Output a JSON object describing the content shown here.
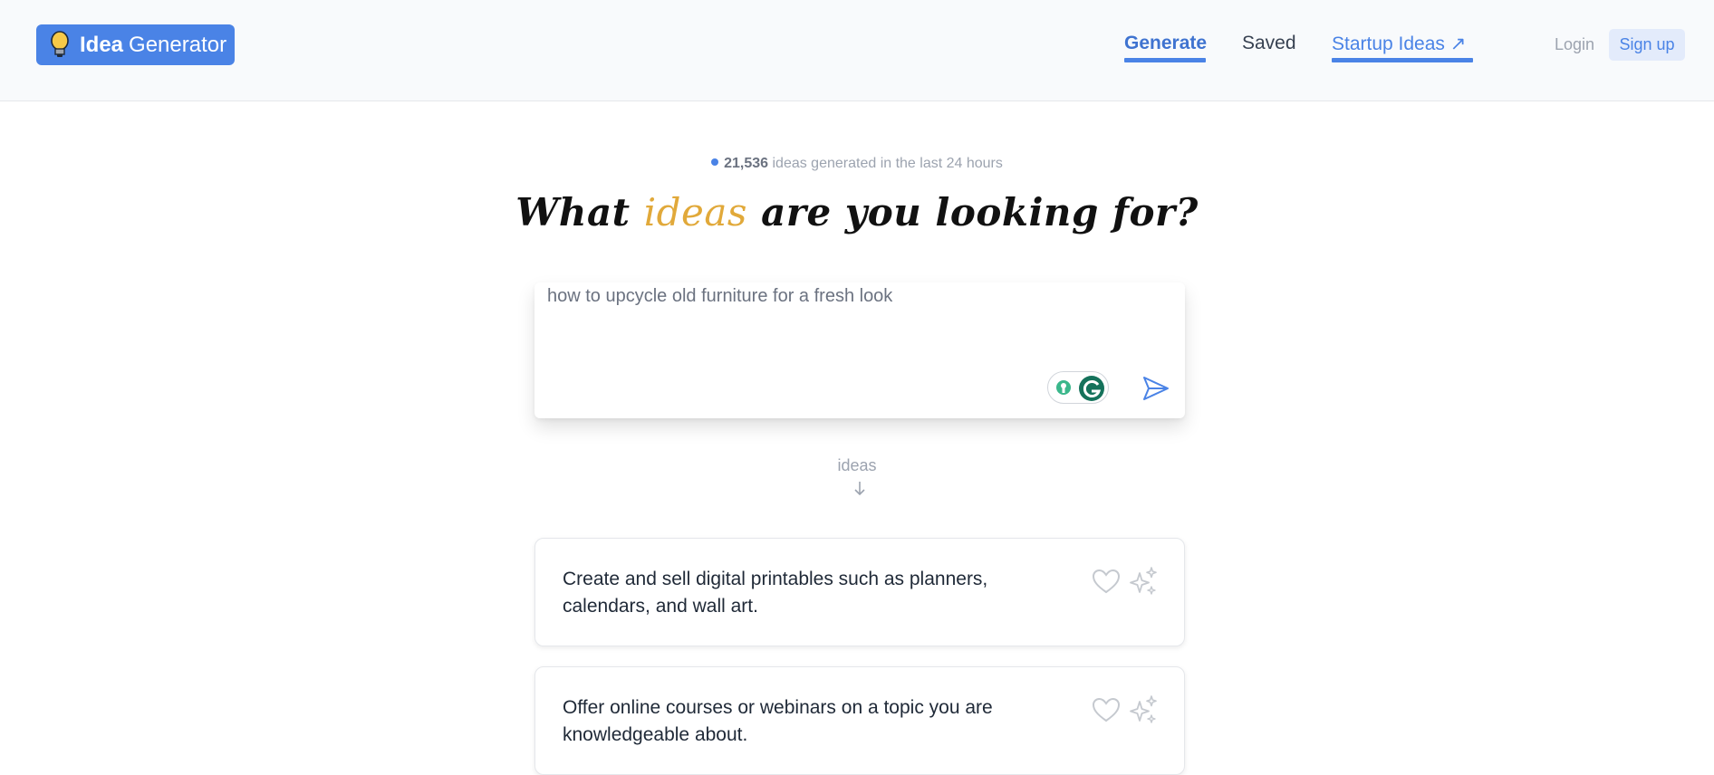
{
  "header": {
    "logo_bold": "Idea",
    "logo_rest": "Generator",
    "nav": {
      "generate": "Generate",
      "saved": "Saved",
      "startup": "Startup Ideas ↗"
    },
    "login": "Login",
    "signup": "Sign up"
  },
  "stats": {
    "count": "21,536",
    "text": "ideas generated in the last 24 hours"
  },
  "headline": {
    "part1": "What ",
    "accent": "ideas",
    "part2": " are you looking for?"
  },
  "input": {
    "value": "how to upcycle old furniture for a fresh look"
  },
  "ideas_label": "ideas",
  "ideas": [
    {
      "text": "Create and sell digital printables such as planners, calendars, and wall art."
    },
    {
      "text": "Offer online courses or webinars on a topic you are knowledgeable about."
    }
  ],
  "colors": {
    "accent": "#4a83e6",
    "highlight": "#e1a93a"
  },
  "icons": [
    "lightbulb-icon",
    "external-arrow-icon",
    "grammarly-icon",
    "send-icon",
    "arrow-down-icon",
    "heart-icon",
    "sparkle-icon"
  ]
}
